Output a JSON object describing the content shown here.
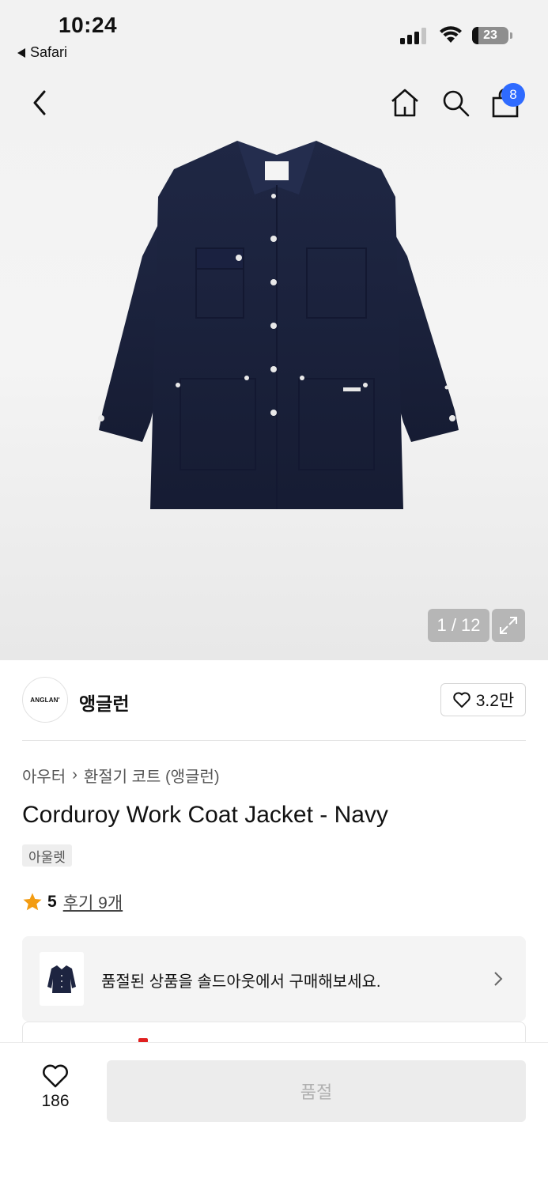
{
  "status_bar": {
    "time": "10:24",
    "back_app": "Safari",
    "battery": "23"
  },
  "header": {
    "cart_count": "8"
  },
  "gallery": {
    "counter": "1 / 12"
  },
  "brand": {
    "logo_text": "ANGLAN'",
    "name": "앵글런",
    "likes": "3.2만"
  },
  "breadcrumb": {
    "items": [
      "아우터",
      "환절기 코트 (앵글런)"
    ]
  },
  "product": {
    "title": "Corduroy Work Coat Jacket - Navy",
    "tag": "아울렛",
    "rating": "5",
    "reviews": "후기 9개"
  },
  "soldout_banner": {
    "text": "품절된 상품을 솔드아웃에서 구매해보세요."
  },
  "bottom_bar": {
    "wish_count": "186",
    "buy_label": "품절"
  },
  "colors": {
    "badge": "#2f6bff",
    "star": "#f39c12",
    "jacket": "#1d2440"
  },
  "icons": [
    "back-icon",
    "home-icon",
    "search-icon",
    "cart-icon",
    "expand-icon",
    "heart-icon",
    "star-icon",
    "chevron-right-icon"
  ]
}
